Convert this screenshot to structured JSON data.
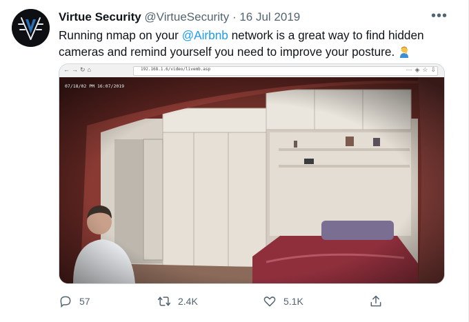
{
  "tweet": {
    "author_name": "Virtue Security",
    "handle": "@VirtueSecurity",
    "separator": "·",
    "date": "16 Jul 2019",
    "more_label": "•••",
    "text_before": "Running nmap on your ",
    "mention": "@Airbnb",
    "text_after": " network is a great way to find hidden cameras and remind yourself you need to improve your posture.",
    "emoji_name": "person-facepalming",
    "text_color": "#0f1419",
    "link_color": "#1d9bf0",
    "muted_color": "#536471"
  },
  "media": {
    "browser": {
      "url": "192.168.1.6/video/livemb.asp",
      "nav_icons": [
        "back-icon",
        "forward-icon",
        "reload-icon",
        "home-icon"
      ],
      "right_icons": [
        "menu-icon",
        "shield-icon",
        "star-icon",
        "download-icon"
      ]
    },
    "camera_timestamp": "07/18/02 PM 16:07/2019",
    "scene_description_icon": "camera-feed-image"
  },
  "actions": {
    "reply_count": "57",
    "retweet_count": "2.4K",
    "like_count": "5.1K"
  }
}
